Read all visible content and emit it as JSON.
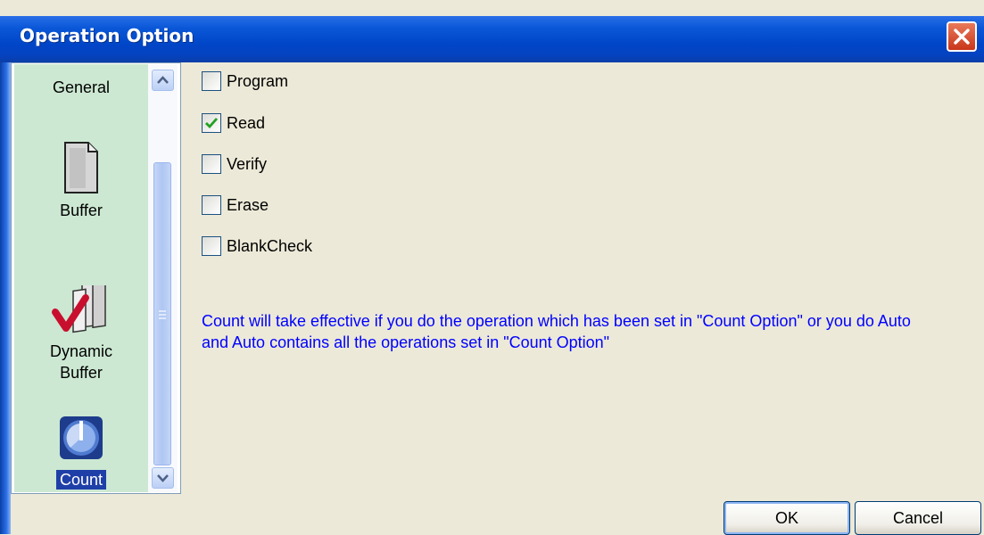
{
  "window": {
    "title": "Operation Option",
    "close_icon": "close-icon",
    "accent": "#0046C8",
    "close_color": "#D9532E"
  },
  "sidebar": {
    "items": [
      {
        "label": "General",
        "selected": false
      },
      {
        "label": "Buffer",
        "icon": "page-icon",
        "selected": false
      },
      {
        "label": "Dynamic\nBuffer",
        "icon": "checkmark-papers-icon",
        "selected": false
      },
      {
        "label": "Count",
        "icon": "count-dial-icon",
        "selected": true
      }
    ],
    "background": "#CCE8D2",
    "selection_color": "#1F3FA8"
  },
  "options": [
    {
      "label": "Program",
      "checked": false
    },
    {
      "label": "Read",
      "checked": true
    },
    {
      "label": "Verify",
      "checked": false
    },
    {
      "label": "Erase",
      "checked": false
    },
    {
      "label": "BlankCheck",
      "checked": false
    }
  ],
  "info": "Count will take effective if you do the operation which has been set in \"Count Option\" or you do Auto and Auto contains all the operations set in \"Count Option\"",
  "info_color": "#0000FF",
  "buttons": {
    "ok": "OK",
    "cancel": "Cancel"
  }
}
